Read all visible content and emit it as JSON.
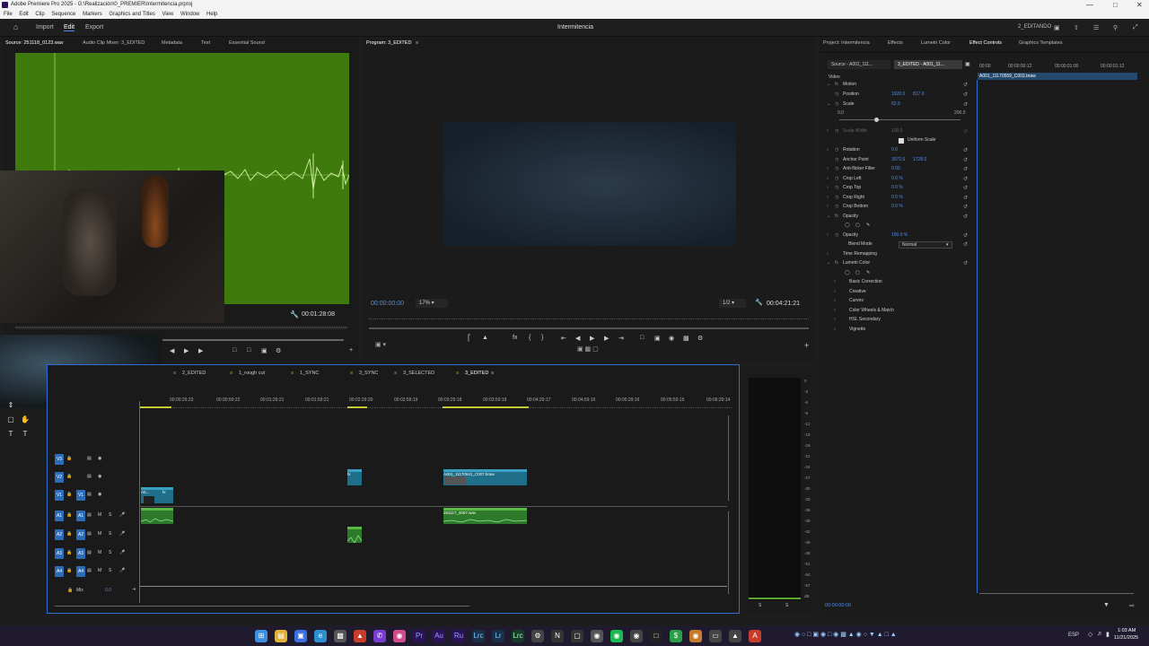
{
  "window": {
    "title": "Adobe Premiere Pro 2025 - G:\\Realización\\0_PREMIER\\Intermitencia.prproj"
  },
  "menu": [
    "File",
    "Edit",
    "Clip",
    "Sequence",
    "Markers",
    "Graphics and Titles",
    "View",
    "Window",
    "Help"
  ],
  "workspace": {
    "tabs": [
      "Import",
      "Edit",
      "Export"
    ],
    "active": "Edit",
    "project_name": "Intermitencia",
    "workspace_name": "2_EDITANDO"
  },
  "source_panel": {
    "tabs": [
      "Source: 251118_0123.wav",
      "Audio Clip Mixer: 3_EDITED",
      "Metadata",
      "Text",
      "Essential Sound"
    ],
    "duration": "00:01:28:08"
  },
  "program_panel": {
    "tab": "Program: 3_EDITED",
    "timecode": "00:00:00:00",
    "zoom": "17%",
    "resolution": "1/2",
    "duration": "00:04:21:21"
  },
  "right_panel": {
    "tabs": [
      "Project: Intermitencia",
      "Effects",
      "Lumetri Color",
      "Effect Controls",
      "Graphics Templates"
    ],
    "active": "Effect Controls",
    "source_selector": "Source - A001_111...",
    "seq_selector": "3_EDITED - A001_11...",
    "ruler": [
      "00:00",
      "00:00:00:12",
      "00:00:01:00",
      "00:00:01:12"
    ],
    "clip_bar": "A001_11170559_C003.braw",
    "section_video": "Video",
    "rows": [
      {
        "label": "Motion",
        "fx": true
      },
      {
        "label": "Position",
        "v1": "1920.0",
        "v2": "817.0"
      },
      {
        "label": "Scale",
        "v1": "62.9"
      },
      {
        "label": "0.0",
        "v1": "",
        "v2": "200.0"
      },
      {
        "label": "Scale Width",
        "v1": "100.0",
        "dim": true
      },
      {
        "label": "Uniform Scale",
        "checkbox": true
      },
      {
        "label": "Rotation",
        "v1": "0.0"
      },
      {
        "label": "Anchor Point",
        "v1": "3072.0",
        "v2": "1728.0"
      },
      {
        "label": "Anti-flicker Filter",
        "v1": "0.00"
      },
      {
        "label": "Crop Left",
        "v1": "0.0 %"
      },
      {
        "label": "Crop Top",
        "v1": "0.0 %"
      },
      {
        "label": "Crop Right",
        "v1": "0.0 %"
      },
      {
        "label": "Crop Bottom",
        "v1": "0.0 %"
      },
      {
        "label": "Opacity",
        "fx": true
      },
      {
        "label": "",
        "icons": true
      },
      {
        "label": "Opacity",
        "v1": "100.0 %"
      },
      {
        "label": "Blend Mode",
        "select": "Normal"
      },
      {
        "label": "Time Remapping",
        "fx": true
      },
      {
        "label": "Lumetri Color",
        "fx": true
      },
      {
        "label": "",
        "icons": true
      },
      {
        "label": "Basic Correction"
      },
      {
        "label": "Creative"
      },
      {
        "label": "Curves"
      },
      {
        "label": "Color Wheels & Match"
      },
      {
        "label": "HSL Secondary"
      },
      {
        "label": "Vignette"
      }
    ],
    "bottom_timecode": "00:00:00:00"
  },
  "timeline": {
    "tabs": [
      "2_EDITED",
      "1_rough cut",
      "1_SYNC",
      "3_SYNC",
      "3_SELECTED",
      "3_EDITED"
    ],
    "active": "3_EDITED",
    "ruler": [
      "00:00:29:23",
      "00:00:59:22",
      "00:01:29:21",
      "00:01:59:21",
      "00:02:29:20",
      "00:02:59:19",
      "00:03:29:18",
      "00:03:59:18",
      "00:04:29:17",
      "00:04:59:16",
      "00:05:29:16",
      "00:05:59:15",
      "00:06:29:14"
    ],
    "tracks": [
      {
        "id": "V3"
      },
      {
        "id": "V2"
      },
      {
        "id": "V1"
      },
      {
        "id": "A1",
        "audio": true
      },
      {
        "id": "A2",
        "audio": true
      },
      {
        "id": "A3",
        "audio": true
      },
      {
        "id": "A4",
        "audio": true
      }
    ],
    "mix_label": "Mix",
    "mix_value": "0.0",
    "clips": {
      "v2a": "fx",
      "v2b": "A001_11170641_C007.braw",
      "v1": "A0...",
      "a1a": "",
      "a1b": "251117_0067.wav"
    }
  },
  "meter_ticks": [
    "0",
    "-6",
    "-12",
    "-18",
    "-24",
    "-30",
    "-36",
    "-42",
    "-48",
    "-54",
    "-dB"
  ],
  "meter_ticks_full": [
    "0",
    "-3",
    "-6",
    "-9",
    "-12",
    "-15",
    "-18",
    "-21",
    "-24",
    "-27",
    "-30",
    "-33",
    "-36",
    "-39",
    "-42",
    "-45",
    "-48",
    "-51",
    "-54",
    "-57",
    "dB"
  ],
  "meter_footer": [
    "S",
    "S"
  ],
  "taskbar": {
    "time": "1:03 AM",
    "date": "11/21/2025",
    "lang": "ESP"
  }
}
